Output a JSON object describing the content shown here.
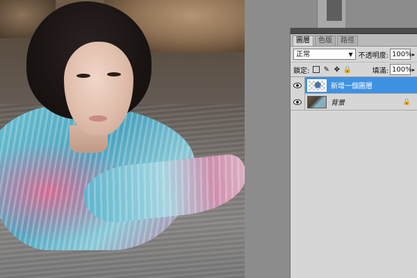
{
  "layers_panel": {
    "tabs": [
      {
        "label": "圖層",
        "active": true
      },
      {
        "label": "色版",
        "active": false
      },
      {
        "label": "路徑",
        "active": false
      }
    ],
    "blend_mode": "正常",
    "opacity_label": "不透明度:",
    "opacity_value": "100%",
    "lock_label": "鎖定:",
    "fill_label": "填滿:",
    "fill_value": "100%",
    "icons": [
      "lock-transparent-icon",
      "brush-icon",
      "move-icon",
      "lock-all-icon"
    ],
    "layers": [
      {
        "name": "新增一個圖層",
        "selected": true,
        "visible": true,
        "thumb": "transparent",
        "italic": false
      },
      {
        "name": "背景",
        "selected": false,
        "visible": true,
        "thumb": "photo",
        "italic": true,
        "locked": true
      }
    ]
  },
  "colors": {
    "selection": "#3f92e2",
    "panel_bg": "#d6d6d6",
    "workspace_bg": "#8c8c8c"
  }
}
